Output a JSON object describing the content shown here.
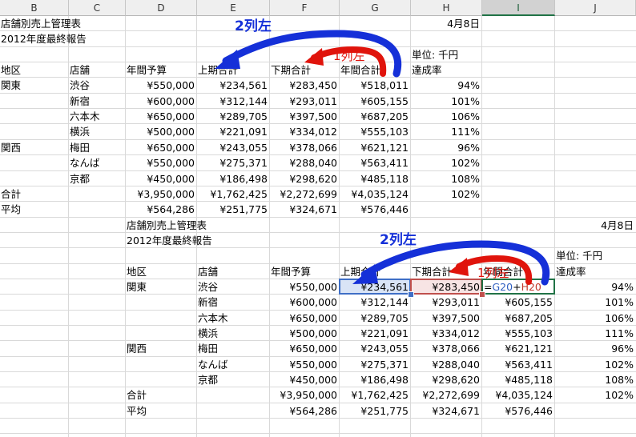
{
  "columns": [
    "B",
    "C",
    "D",
    "E",
    "F",
    "G",
    "H",
    "I",
    "J"
  ],
  "selected_column": "I",
  "top": {
    "title": "店舗別売上管理表",
    "subtitle": "2012年度最終報告",
    "date": "4月8日",
    "unit": "単位: 千円",
    "headers": [
      "地区",
      "店舗",
      "年間予算",
      "上期合計",
      "下期合計",
      "年間合計",
      "達成率"
    ],
    "rows": [
      [
        "関東",
        "渋谷",
        "¥550,000",
        "¥234,561",
        "¥283,450",
        "¥518,011",
        "94%"
      ],
      [
        "",
        "新宿",
        "¥600,000",
        "¥312,144",
        "¥293,011",
        "¥605,155",
        "101%"
      ],
      [
        "",
        "六本木",
        "¥650,000",
        "¥289,705",
        "¥397,500",
        "¥687,205",
        "106%"
      ],
      [
        "",
        "横浜",
        "¥500,000",
        "¥221,091",
        "¥334,012",
        "¥555,103",
        "111%"
      ],
      [
        "関西",
        "梅田",
        "¥650,000",
        "¥243,055",
        "¥378,066",
        "¥621,121",
        "96%"
      ],
      [
        "",
        "なんば",
        "¥550,000",
        "¥275,371",
        "¥288,040",
        "¥563,411",
        "102%"
      ],
      [
        "",
        "京都",
        "¥450,000",
        "¥186,498",
        "¥298,620",
        "¥485,118",
        "108%"
      ],
      [
        "合計",
        "",
        "¥3,950,000",
        "¥1,762,425",
        "¥2,272,699",
        "¥4,035,124",
        "102%"
      ],
      [
        "平均",
        "",
        "¥564,286",
        "¥251,775",
        "¥324,671",
        "¥576,446",
        ""
      ]
    ],
    "annotation_2": "2列左",
    "annotation_1": "1列左"
  },
  "bottom": {
    "title": "店舗別売上管理表",
    "subtitle": "2012年度最終報告",
    "date": "4月8日",
    "unit": "単位: 千円",
    "headers": [
      "地区",
      "店舗",
      "年間予算",
      "上期合計",
      "下期合計",
      "年間合計",
      "達成率"
    ],
    "rows": [
      [
        "関東",
        "渋谷",
        "¥550,000",
        "¥234,561",
        "¥283,450",
        "",
        "94%"
      ],
      [
        "",
        "新宿",
        "¥600,000",
        "¥312,144",
        "¥293,011",
        "¥605,155",
        "101%"
      ],
      [
        "",
        "六本木",
        "¥650,000",
        "¥289,705",
        "¥397,500",
        "¥687,205",
        "106%"
      ],
      [
        "",
        "横浜",
        "¥500,000",
        "¥221,091",
        "¥334,012",
        "¥555,103",
        "111%"
      ],
      [
        "関西",
        "梅田",
        "¥650,000",
        "¥243,055",
        "¥378,066",
        "¥621,121",
        "96%"
      ],
      [
        "",
        "なんば",
        "¥550,000",
        "¥275,371",
        "¥288,040",
        "¥563,411",
        "102%"
      ],
      [
        "",
        "京都",
        "¥450,000",
        "¥186,498",
        "¥298,620",
        "¥485,118",
        "108%"
      ],
      [
        "合計",
        "",
        "¥3,950,000",
        "¥1,762,425",
        "¥2,272,699",
        "¥4,035,124",
        "102%"
      ],
      [
        "平均",
        "",
        "¥564,286",
        "¥251,775",
        "¥324,671",
        "¥576,446",
        ""
      ]
    ],
    "formula": {
      "eq": "=",
      "ref1": "G20",
      "plus": "+",
      "ref2": "H20"
    },
    "annotation_2": "2列左",
    "annotation_1": "1列左"
  },
  "colors": {
    "blue": "#1530d8",
    "red": "#e0140c",
    "ref_blue": "#3f6fc6",
    "ref_red": "#c0504d",
    "active": "#217346"
  }
}
